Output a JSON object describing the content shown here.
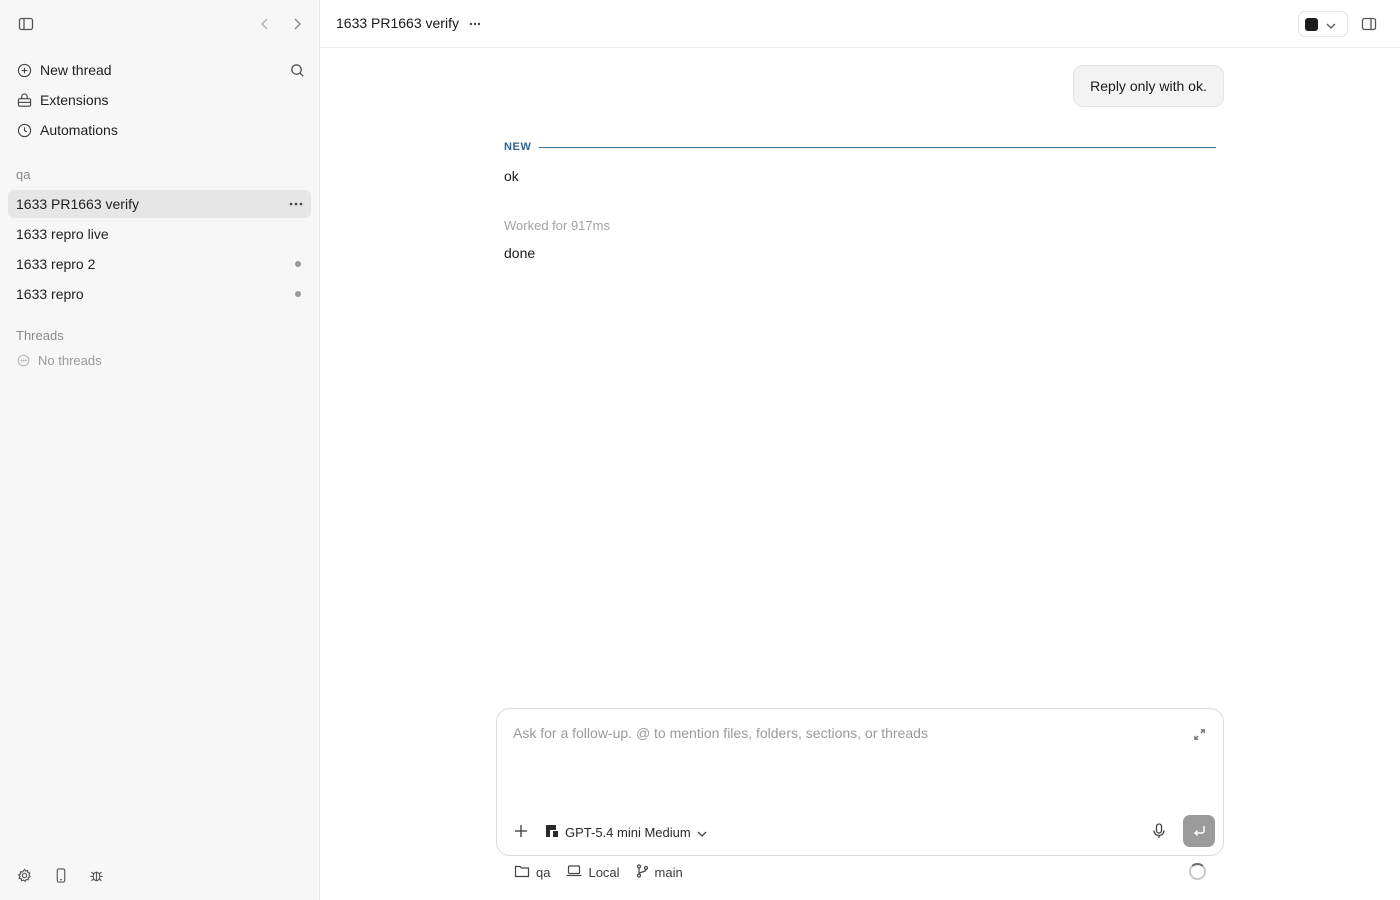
{
  "sidebar": {
    "nav": [
      {
        "label": "New thread",
        "icon": "plus-circle-icon"
      },
      {
        "label": "Extensions",
        "icon": "extensions-icon"
      },
      {
        "label": "Automations",
        "icon": "clock-icon"
      }
    ],
    "project_label": "qa",
    "project_threads": [
      {
        "label": "1633 PR1663 verify",
        "active": true
      },
      {
        "label": "1633 repro live"
      },
      {
        "label": "1633 repro 2",
        "unread": true
      },
      {
        "label": "1633 repro",
        "unread": true
      }
    ],
    "threads_section_label": "Threads",
    "no_threads_text": "No threads"
  },
  "header": {
    "title": "1633 PR1663 verify",
    "more_glyph": "···"
  },
  "conversation": {
    "user_message": "Reply only with ok.",
    "new_marker": "NEW",
    "assistant_reply": "ok",
    "worked_for": "Worked for 917ms",
    "final_text": "done"
  },
  "composer": {
    "placeholder": "Ask for a follow-up. @ to mention files, folders, sections, or threads",
    "model_label": "GPT-5.4 mini Medium"
  },
  "footer": {
    "folder": "qa",
    "environment": "Local",
    "branch": "main"
  },
  "colors": {
    "accent_divider": "#2f6690",
    "sidebar_bg": "#f7f7f7",
    "active_item_bg": "#e6e6e6"
  }
}
